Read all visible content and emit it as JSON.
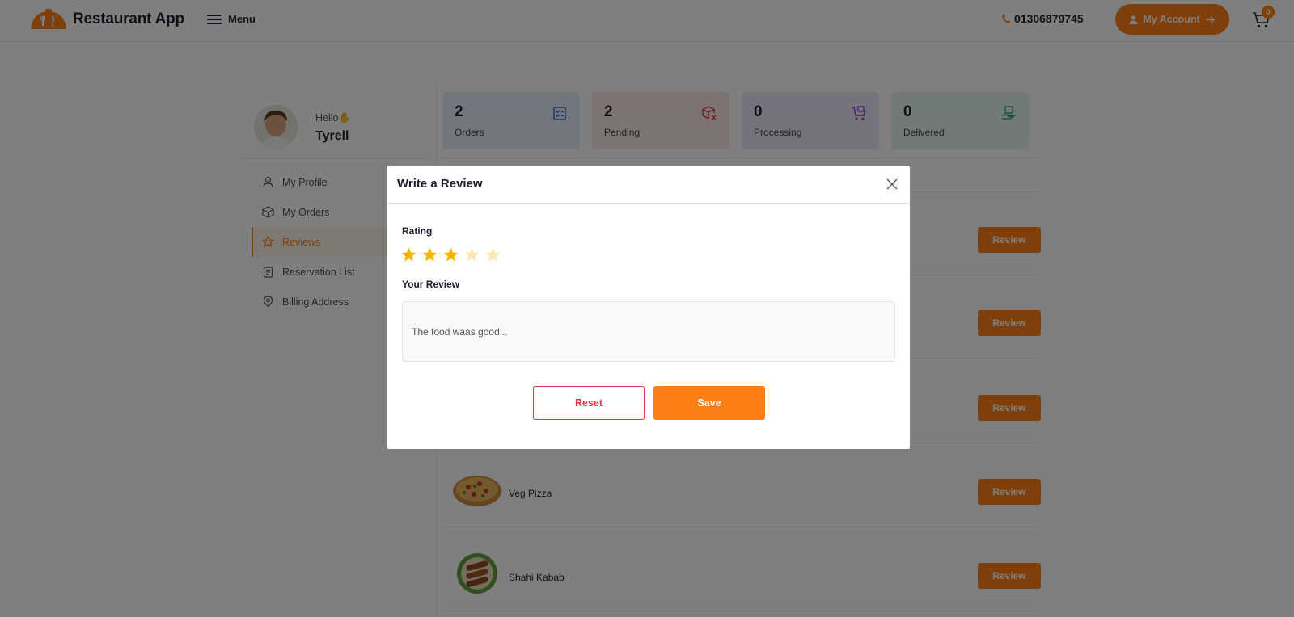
{
  "header": {
    "app_name": "Restaurant App",
    "menu_label": "Menu",
    "phone": "01306879745",
    "account_label": "My Account",
    "cart_count": "0"
  },
  "user": {
    "greeting": "Hello",
    "name": "Tyrell"
  },
  "sidebar": {
    "items": [
      {
        "label": "My Profile",
        "icon": "user-icon"
      },
      {
        "label": "My Orders",
        "icon": "box-icon"
      },
      {
        "label": "Reviews",
        "icon": "star-icon",
        "active": true
      },
      {
        "label": "Reservation List",
        "icon": "clipboard-icon"
      },
      {
        "label": "Billing Address",
        "icon": "location-pin-icon"
      }
    ]
  },
  "stats": [
    {
      "value": "2",
      "label": "Orders",
      "color": "#e5eefb",
      "icon_color": "#3b6fd4"
    },
    {
      "value": "2",
      "label": "Pending",
      "color": "#fbe6e6",
      "icon_color": "#d43b3b"
    },
    {
      "value": "0",
      "label": "Processing",
      "color": "#ede6fb",
      "icon_color": "#7a3bd4"
    },
    {
      "value": "0",
      "label": "Delivered",
      "color": "#e3f5ec",
      "icon_color": "#2ea86b"
    }
  ],
  "reviews": {
    "button_label": "Review",
    "rows": [
      {
        "name": ""
      },
      {
        "name": ""
      },
      {
        "name": ""
      },
      {
        "name": "Veg Pizza",
        "image": "pizza"
      },
      {
        "name": "Shahi Kabab",
        "image": "kabab"
      }
    ]
  },
  "modal": {
    "title": "Write a Review",
    "rating_label": "Rating",
    "rating": 3,
    "max_rating": 5,
    "review_label": "Your Review",
    "review_value": "The food waas good...",
    "reset_label": "Reset",
    "save_label": "Save"
  },
  "colors": {
    "accent": "#fd7e14",
    "danger": "#dc3545",
    "star": "#f5b400"
  }
}
